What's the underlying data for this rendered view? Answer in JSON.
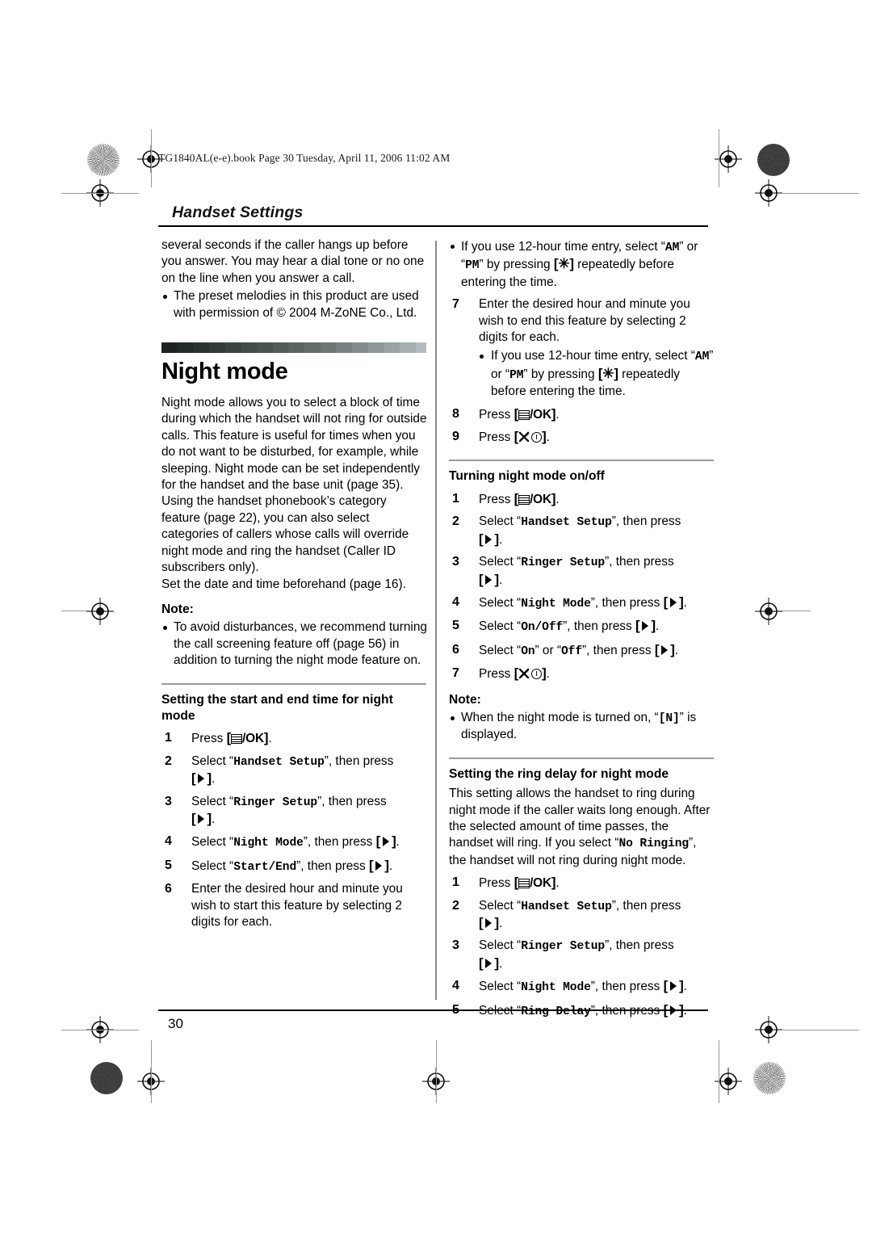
{
  "document": {
    "file_stamp": "TG1840AL(e-e).book  Page 30  Tuesday, April 11, 2006  11:02 AM",
    "running_head": "Handset Settings",
    "page_number": "30"
  },
  "left_column": {
    "continued_paragraph": "several seconds if the caller hangs up before you answer. You may hear a dial tone or no one on the line when you answer a call.",
    "bullet_melodies": "The preset melodies in this product are used with permission of © 2004 M-ZoNE Co., Ltd.",
    "chapter_title": "Night mode",
    "intro_paragraph_1": "Night mode allows you to select a block of time during which the handset will not ring for outside calls. This feature is useful for times when you do not want to be disturbed, for example, while sleeping. Night mode can be set independently for the handset and the base unit (page 35).",
    "intro_paragraph_2": "Using the handset phonebook’s category feature (page 22), you can also select categories of callers whose calls will override night mode and ring the handset (Caller ID subscribers only).",
    "intro_paragraph_3": "Set the date and time beforehand (page 16).",
    "note_label": "Note:",
    "note_bullet": "To avoid disturbances, we recommend turning the call screening feature off (page 56) in addition to turning the night mode feature on.",
    "section_heading": "Setting the start and end time for night mode",
    "steps": [
      {
        "num": "1",
        "pre": "Press ",
        "key": "menu-ok",
        "post": "."
      },
      {
        "num": "2",
        "pre": "Select “",
        "mono": "Handset Setup",
        "mid": "”, then press ",
        "key": "right-arrow",
        "post": "."
      },
      {
        "num": "3",
        "pre": "Select “",
        "mono": "Ringer Setup",
        "mid": "”, then press ",
        "key": "right-arrow",
        "post": "."
      },
      {
        "num": "4",
        "pre": "Select “",
        "mono": "Night Mode",
        "mid": "”, then press ",
        "key": "right-arrow",
        "post": "."
      },
      {
        "num": "5",
        "pre": "Select “",
        "mono": "Start/End",
        "mid": "”, then press ",
        "key": "right-arrow",
        "post": "."
      },
      {
        "num": "6",
        "text": "Enter the desired hour and minute you wish to start this feature by selecting 2 digits for each."
      }
    ]
  },
  "right_column": {
    "bullet_12hour_1": {
      "pre": "If you use 12-hour time entry, select “",
      "mono_am": "AM",
      "mid": "” or “",
      "mono_pm": "PM",
      "mid2": "” by pressing ",
      "key": "star",
      "post": " repeatedly before entering the time."
    },
    "step7": {
      "num": "7",
      "text": "Enter the desired hour and minute you wish to end this feature by selecting 2 digits for each."
    },
    "bullet_12hour_2": {
      "pre": "If you use 12-hour time entry, select “",
      "mono_am": "AM",
      "mid": "” or “",
      "mono_pm": "PM",
      "mid2": "” by pressing ",
      "key": "star",
      "post": " repeatedly before entering the time."
    },
    "step8": {
      "num": "8",
      "pre": "Press ",
      "key": "menu-ok",
      "post": "."
    },
    "step9": {
      "num": "9",
      "pre": "Press ",
      "key": "phone-off-power",
      "post": "."
    },
    "section_heading_onoff": "Turning night mode on/off",
    "steps_onoff": [
      {
        "num": "1",
        "pre": "Press ",
        "key": "menu-ok",
        "post": "."
      },
      {
        "num": "2",
        "pre": "Select “",
        "mono": "Handset Setup",
        "mid": "”, then press ",
        "key": "right-arrow",
        "post": "."
      },
      {
        "num": "3",
        "pre": "Select “",
        "mono": "Ringer Setup",
        "mid": "”, then press ",
        "key": "right-arrow",
        "post": "."
      },
      {
        "num": "4",
        "pre": "Select “",
        "mono": "Night Mode",
        "mid": "”, then press ",
        "key": "right-arrow",
        "post": "."
      },
      {
        "num": "5",
        "pre": "Select “",
        "mono": "On/Off",
        "mid": "”, then press ",
        "key": "right-arrow",
        "post": "."
      },
      {
        "num": "6",
        "pre": "Select “",
        "mono": "On",
        "mid": "” or “",
        "mono2": "Off",
        "mid2": "”, then press ",
        "key": "right-arrow",
        "post": "."
      },
      {
        "num": "7",
        "pre": "Press ",
        "key": "phone-off-power",
        "post": "."
      }
    ],
    "note_label": "Note:",
    "note_bullet": {
      "pre": "When the night mode is turned on, “",
      "mono": "[N]",
      "post": "” is displayed."
    },
    "section_heading_delay": "Setting the ring delay for night mode",
    "delay_paragraph": {
      "pre": "This setting allows the handset to ring during night mode if the caller waits long enough. After the selected amount of time passes, the handset will ring. If you select “",
      "mono": "No Ringing",
      "post": "”, the handset will not ring during night mode."
    },
    "steps_delay": [
      {
        "num": "1",
        "pre": "Press ",
        "key": "menu-ok",
        "post": "."
      },
      {
        "num": "2",
        "pre": "Select “",
        "mono": "Handset Setup",
        "mid": "”, then press ",
        "key": "right-arrow",
        "post": "."
      },
      {
        "num": "3",
        "pre": "Select “",
        "mono": "Ringer Setup",
        "mid": "”, then press ",
        "key": "right-arrow",
        "post": "."
      },
      {
        "num": "4",
        "pre": "Select “",
        "mono": "Night Mode",
        "mid": "”, then press ",
        "key": "right-arrow",
        "post": "."
      },
      {
        "num": "5",
        "pre": "Select “",
        "mono": "Ring Delay",
        "mid": "”, then press ",
        "key": "right-arrow",
        "post": "."
      }
    ]
  },
  "prepress": {
    "marks": [
      "registration-target",
      "rosette",
      "trim-line"
    ]
  }
}
